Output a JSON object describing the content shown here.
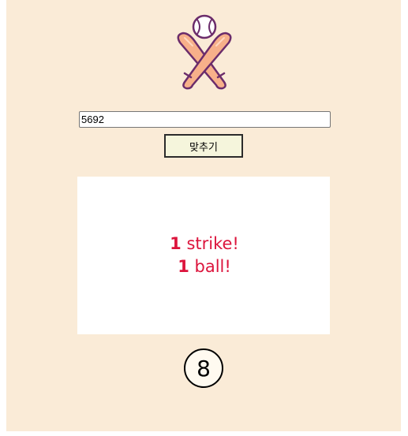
{
  "logo": {
    "icon": "baseball-bats-icon"
  },
  "guess": {
    "value": "5692"
  },
  "submit": {
    "label": "맞추기"
  },
  "result": {
    "strike_count": "1",
    "strike_label": "strike!",
    "ball_count": "1",
    "ball_label": "ball!"
  },
  "attempts": {
    "remaining": "8"
  },
  "colors": {
    "page_background": "#faebd7",
    "result_text": "#dc143c",
    "button_background": "#f5f5dc",
    "bat": "#f7b08a",
    "outline": "#6b2c6b"
  }
}
